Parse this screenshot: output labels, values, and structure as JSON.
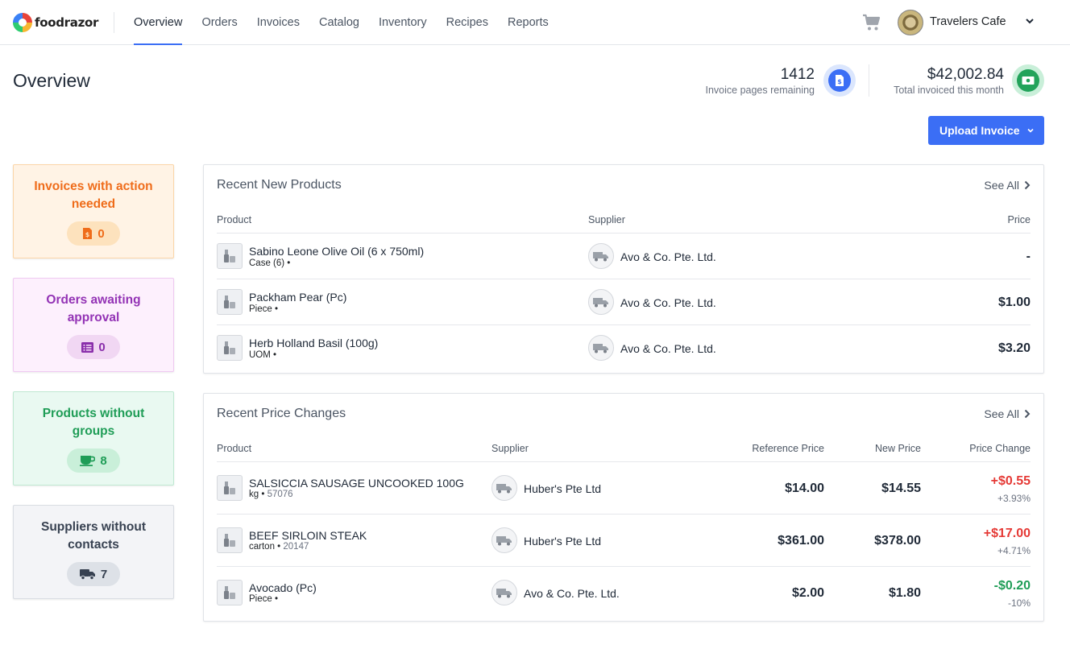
{
  "brand": {
    "name": "foodrazor"
  },
  "nav": {
    "items": [
      "Overview",
      "Orders",
      "Invoices",
      "Catalog",
      "Inventory",
      "Recipes",
      "Reports"
    ],
    "active": "Overview"
  },
  "venue": {
    "name": "Travelers Cafe"
  },
  "page": {
    "title": "Overview"
  },
  "stats": {
    "pages_remaining": {
      "value": "1412",
      "label": "Invoice pages remaining"
    },
    "total_invoiced": {
      "value": "$42,002.84",
      "label": "Total invoiced this month"
    }
  },
  "upload": {
    "label": "Upload Invoice"
  },
  "side_cards": [
    {
      "title": "Invoices with action needed",
      "count": "0",
      "icon": "invoice-icon",
      "color": "#ef6c1a"
    },
    {
      "title": "Orders awaiting approval",
      "count": "0",
      "icon": "list-icon",
      "color": "#9333b5"
    },
    {
      "title": "Products without groups",
      "count": "8",
      "icon": "cup-icon",
      "color": "#1f9d57"
    },
    {
      "title": "Suppliers without contacts",
      "count": "7",
      "icon": "truck-icon",
      "color": "#374151"
    }
  ],
  "recent_products": {
    "title": "Recent New Products",
    "see_all": "See All",
    "headers": {
      "product": "Product",
      "supplier": "Supplier",
      "price": "Price"
    },
    "rows": [
      {
        "name": "Sabino Leone Olive Oil (6 x 750ml)",
        "unit": "Case (6)",
        "code": "",
        "supplier": "Avo & Co. Pte. Ltd.",
        "price": "-"
      },
      {
        "name": "Packham Pear (Pc)",
        "unit": "Piece",
        "code": "",
        "supplier": "Avo & Co. Pte. Ltd.",
        "price": "$1.00"
      },
      {
        "name": "Herb Holland Basil (100g)",
        "unit": "UOM",
        "code": "",
        "supplier": "Avo & Co. Pte. Ltd.",
        "price": "$3.20"
      }
    ]
  },
  "price_changes": {
    "title": "Recent Price Changes",
    "see_all": "See All",
    "headers": {
      "product": "Product",
      "supplier": "Supplier",
      "reference": "Reference Price",
      "new": "New Price",
      "change": "Price Change"
    },
    "rows": [
      {
        "name": "SALSICCIA SAUSAGE UNCOOKED 100G",
        "unit": "kg",
        "code": "57076",
        "supplier": "Huber's Pte Ltd",
        "reference": "$14.00",
        "new": "$14.55",
        "change": "+$0.55",
        "pct": "+3.93%",
        "direction": "up"
      },
      {
        "name": "BEEF SIRLOIN STEAK",
        "unit": "carton",
        "code": "20147",
        "supplier": "Huber's Pte Ltd",
        "reference": "$361.00",
        "new": "$378.00",
        "change": "+$17.00",
        "pct": "+4.71%",
        "direction": "up"
      },
      {
        "name": "Avocado (Pc)",
        "unit": "Piece",
        "code": "",
        "supplier": "Avo & Co. Pte. Ltd.",
        "reference": "$2.00",
        "new": "$1.80",
        "change": "-$0.20",
        "pct": "-10%",
        "direction": "down"
      }
    ]
  },
  "colors": {
    "accent": "#3b6ef5",
    "increase": "#e53935",
    "decrease": "#1f9d57"
  }
}
